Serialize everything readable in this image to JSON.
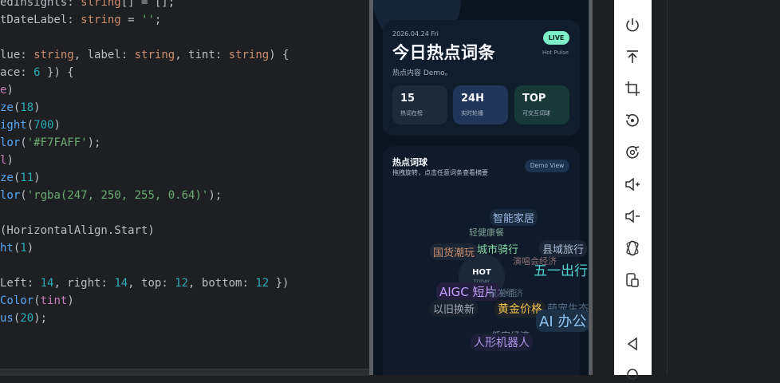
{
  "editor": {
    "lines": [
      [
        {
          "t": "edInsights",
          "c": "t-param"
        },
        {
          "t": ": ",
          "c": ""
        },
        {
          "t": "string",
          "c": "t-type"
        },
        {
          "t": "[] = [];",
          "c": ""
        }
      ],
      [
        {
          "t": "tDateLabel",
          "c": "t-param"
        },
        {
          "t": ": ",
          "c": ""
        },
        {
          "t": "string",
          "c": "t-type"
        },
        {
          "t": " = ",
          "c": ""
        },
        {
          "t": "''",
          "c": "t-str"
        },
        {
          "t": ";",
          "c": ""
        }
      ],
      [],
      [
        {
          "t": "lue",
          "c": "t-param"
        },
        {
          "t": ": ",
          "c": ""
        },
        {
          "t": "string",
          "c": "t-type"
        },
        {
          "t": ", ",
          "c": ""
        },
        {
          "t": "label",
          "c": "t-param"
        },
        {
          "t": ": ",
          "c": ""
        },
        {
          "t": "string",
          "c": "t-type"
        },
        {
          "t": ", ",
          "c": ""
        },
        {
          "t": "tint",
          "c": "t-param"
        },
        {
          "t": ": ",
          "c": ""
        },
        {
          "t": "string",
          "c": "t-type"
        },
        {
          "t": ") {",
          "c": ""
        }
      ],
      [
        {
          "t": "ace",
          "c": "t-param"
        },
        {
          "t": ": ",
          "c": ""
        },
        {
          "t": "6",
          "c": "t-num"
        },
        {
          "t": " }) {",
          "c": ""
        }
      ],
      [
        {
          "t": "e",
          "c": "t-prop"
        },
        {
          "t": ")",
          "c": ""
        }
      ],
      [
        {
          "t": "ze",
          "c": "t-fn"
        },
        {
          "t": "(",
          "c": ""
        },
        {
          "t": "18",
          "c": "t-num"
        },
        {
          "t": ")",
          "c": ""
        }
      ],
      [
        {
          "t": "ight",
          "c": "t-fn"
        },
        {
          "t": "(",
          "c": ""
        },
        {
          "t": "700",
          "c": "t-num"
        },
        {
          "t": ")",
          "c": ""
        }
      ],
      [
        {
          "t": "lor",
          "c": "t-fn"
        },
        {
          "t": "(",
          "c": ""
        },
        {
          "t": "'#F7FAFF'",
          "c": "t-str"
        },
        {
          "t": ");",
          "c": ""
        }
      ],
      [
        {
          "t": "l",
          "c": "t-prop"
        },
        {
          "t": ")",
          "c": ""
        }
      ],
      [
        {
          "t": "ze",
          "c": "t-fn"
        },
        {
          "t": "(",
          "c": ""
        },
        {
          "t": "11",
          "c": "t-num"
        },
        {
          "t": ")",
          "c": ""
        }
      ],
      [
        {
          "t": "lor",
          "c": "t-fn"
        },
        {
          "t": "(",
          "c": ""
        },
        {
          "t": "'rgba(247, 250, 255, 0.64)'",
          "c": "t-str"
        },
        {
          "t": ");",
          "c": ""
        }
      ],
      [],
      [
        {
          "t": "(HorizontalAlign.Start)",
          "c": ""
        }
      ],
      [
        {
          "t": "ht",
          "c": "t-fn"
        },
        {
          "t": "(",
          "c": ""
        },
        {
          "t": "1",
          "c": "t-num"
        },
        {
          "t": ")",
          "c": ""
        }
      ],
      [],
      [
        {
          "t": "Left",
          "c": "t-param"
        },
        {
          "t": ": ",
          "c": ""
        },
        {
          "t": "14",
          "c": "t-num"
        },
        {
          "t": ", ",
          "c": ""
        },
        {
          "t": "right",
          "c": "t-param"
        },
        {
          "t": ": ",
          "c": ""
        },
        {
          "t": "14",
          "c": "t-num"
        },
        {
          "t": ", ",
          "c": ""
        },
        {
          "t": "top",
          "c": "t-param"
        },
        {
          "t": ": ",
          "c": ""
        },
        {
          "t": "12",
          "c": "t-num"
        },
        {
          "t": ", ",
          "c": ""
        },
        {
          "t": "bottom",
          "c": "t-param"
        },
        {
          "t": ": ",
          "c": ""
        },
        {
          "t": "12",
          "c": "t-num"
        },
        {
          "t": " })",
          "c": ""
        }
      ],
      [
        {
          "t": "Color",
          "c": "t-fn"
        },
        {
          "t": "(",
          "c": ""
        },
        {
          "t": "tint",
          "c": "t-prop"
        },
        {
          "t": ")",
          "c": ""
        }
      ],
      [
        {
          "t": "us",
          "c": "t-fn"
        },
        {
          "t": "(",
          "c": ""
        },
        {
          "t": "20",
          "c": "t-num"
        },
        {
          "t": ");",
          "c": ""
        }
      ]
    ]
  },
  "phone": {
    "date": "2026.04.24 Fri",
    "title": "今日热点词条",
    "subtitle": "热点内容 Demo。",
    "live_badge": "LIVE",
    "pulse_label": "Hot Pulse",
    "stats": [
      {
        "value": "15",
        "label": "热词在榜",
        "bg": "#1c2a3a"
      },
      {
        "value": "24H",
        "label": "实时轮播",
        "bg": "#223659"
      },
      {
        "value": "TOP",
        "label": "可交互词球",
        "bg": "#173937"
      }
    ],
    "cloud": {
      "title": "热点词球",
      "subtitle": "拖拽旋转，点击任意词条查看摘要",
      "demo_button": "Demo View",
      "hot_label": "HOT",
      "today_label": "TODAY",
      "words": [
        {
          "text": "智能家居",
          "color": "#9db8e3",
          "size": 13,
          "bg": "#1a2a3e"
        },
        {
          "text": "轻健康餐",
          "color": "#7f9f93",
          "size": 11,
          "bg": ""
        },
        {
          "text": "国货潮玩",
          "color": "#c98d6a",
          "size": 13,
          "bg": "#1c2535"
        },
        {
          "text": "城市骑行",
          "color": "#86d9a6",
          "size": 13,
          "bg": ""
        },
        {
          "text": "县域旅行",
          "color": "#a9bcd6",
          "size": 13,
          "bg": "#1b2535"
        },
        {
          "text": "演唱会经济",
          "color": "#8d6e74",
          "size": 11,
          "bg": ""
        },
        {
          "text": "五一出行",
          "color": "#4fd3d1",
          "size": 17,
          "bg": ""
        },
        {
          "text": "AIGC 短片",
          "color": "#c3a0ff",
          "size": 15,
          "bg": "#231f3c"
        },
        {
          "text": "银发经济",
          "color": "#4f6479",
          "size": 11,
          "bg": ""
        },
        {
          "text": "补能",
          "color": "#56697c",
          "size": 11,
          "bg": ""
        },
        {
          "text": "以旧换新",
          "color": "#a2a8b4",
          "size": 13,
          "bg": "#1a2230"
        },
        {
          "text": "黄金价格",
          "color": "#f2c14e",
          "size": 14,
          "bg": "#1e2329"
        },
        {
          "text": "萌宠生态",
          "color": "#566e85",
          "size": 13,
          "bg": ""
        },
        {
          "text": "AI 办公",
          "color": "#8ec4ee",
          "size": 18,
          "bg": "#1c3146"
        },
        {
          "text": "低空经济",
          "color": "#7a7f99",
          "size": 12,
          "bg": ""
        },
        {
          "text": "人形机器人",
          "color": "#b094ea",
          "size": 14,
          "bg": "#1d2038"
        }
      ]
    }
  },
  "toolbar": {
    "icons": [
      "power-icon",
      "volume-up-icon",
      "rotate-left-icon",
      "rotate-right-icon",
      "screenshot-icon",
      "volume-down-icon",
      "fold-icon",
      "snapshot-icon",
      "back-icon",
      "home-icon"
    ]
  }
}
